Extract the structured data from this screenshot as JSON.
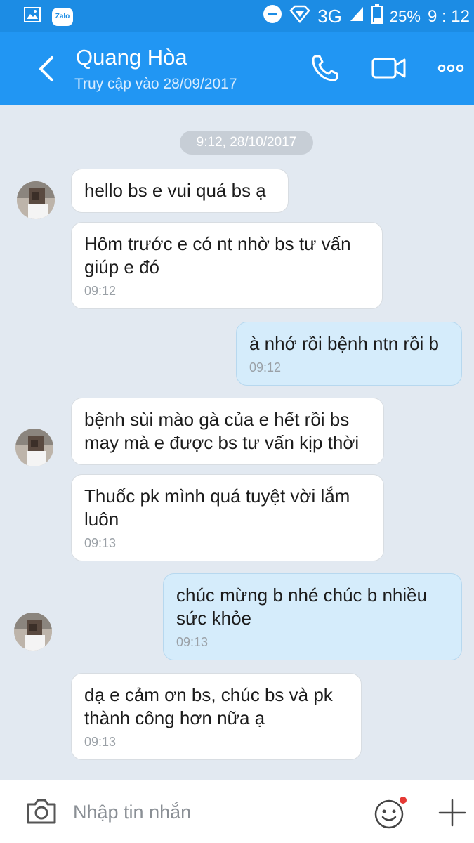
{
  "status_bar": {
    "network": "3G",
    "battery": "25%",
    "time": "9 : 12",
    "app_badge": "Zalo"
  },
  "header": {
    "contact_name": "Quang Hòa",
    "last_seen": "Truy cập vào 28/09/2017"
  },
  "chat": {
    "date_divider": "9:12, 28/10/2017",
    "messages": [
      {
        "direction": "in",
        "text": "hello bs e vui quá bs ạ",
        "time": ""
      },
      {
        "direction": "in",
        "text": "Hôm trước e có nt nhờ bs tư vấn giúp e đó",
        "time": "09:12"
      },
      {
        "direction": "out",
        "text": "à nhớ rồi bệnh ntn rồi b",
        "time": "09:12"
      },
      {
        "direction": "in",
        "text": "bệnh sùi mào gà của e hết rồi bs may mà e được bs tư vấn kịp thời",
        "time": ""
      },
      {
        "direction": "in",
        "text": "Thuốc pk mình quá tuyệt vời lắm luôn",
        "time": "09:13"
      },
      {
        "direction": "out",
        "text": "chúc mừng b nhé chúc b nhiều sức khỏe",
        "time": "09:13"
      },
      {
        "direction": "in",
        "text": "dạ e cảm ơn bs, chúc bs và pk thành công hơn nữa ạ",
        "time": "09:13"
      }
    ]
  },
  "input_bar": {
    "placeholder": "Nhập tin nhắn"
  },
  "colors": {
    "header_blue": "#2196f3",
    "status_blue": "#1c8ce4",
    "chat_bg": "#e2e9f1",
    "outgoing_bubble": "#d5ecfb",
    "incoming_bubble": "#ffffff",
    "notification_dot": "#e53935"
  }
}
